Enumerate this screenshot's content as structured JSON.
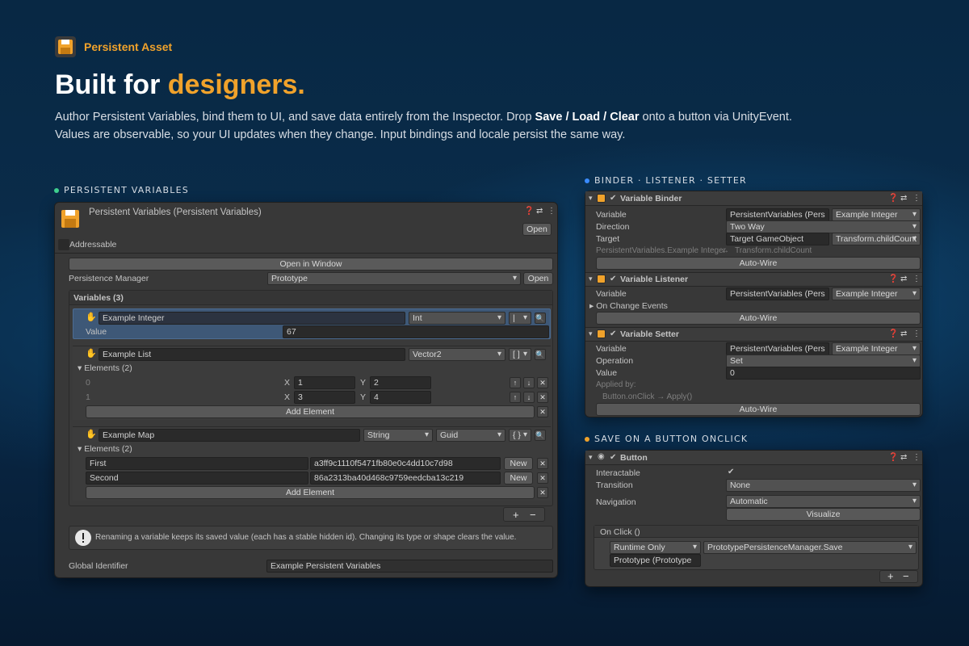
{
  "brand": {
    "name": "Persistent Asset",
    "icon": "floppy-disk-icon"
  },
  "headline": {
    "prefix": "Built for ",
    "accent": "designers."
  },
  "description": {
    "line1_a": "Author Persistent Variables, bind them to UI, and save data entirely from the Inspector. Drop ",
    "line1_b": "Save / Load / Clear",
    "line1_c": " onto a button via UnityEvent.",
    "line2": "Values are observable, so your UI updates when they change. Input bindings and locale persist the same way."
  },
  "colors": {
    "accent": "#f0a22b",
    "green_dot": "#3ecf8e",
    "blue_dot": "#3b8cff",
    "orange_dot": "#f0a22b"
  },
  "sections": {
    "persistent": "PERSISTENT VARIABLES",
    "binder": "BINDER · LISTENER · SETTER",
    "save": "SAVE ON A BUTTON ONCLICK"
  },
  "inspector": {
    "title": "Persistent Variables (Persistent Variables)",
    "open": "Open",
    "addressable": "Addressable",
    "open_window": "Open in Window",
    "pm_label": "Persistence Manager",
    "pm_value": "Prototype",
    "pm_open": "Open",
    "variables_header": "Variables (3)",
    "var1": {
      "name": "Example Integer",
      "type": "Int",
      "value_label": "Value",
      "value": "67",
      "shape": "|"
    },
    "var2": {
      "name": "Example List",
      "type": "Vector2",
      "shape": "[ ]",
      "elements": "Elements (2)",
      "rows": [
        {
          "idx": "0",
          "x": "1",
          "y": "2"
        },
        {
          "idx": "1",
          "x": "3",
          "y": "4"
        }
      ],
      "x_label": "X",
      "y_label": "Y",
      "add": "Add Element"
    },
    "var3": {
      "name": "Example Map",
      "key_type": "String",
      "value_type": "Guid",
      "shape": "{ }",
      "elements": "Elements (2)",
      "rows": [
        {
          "key": "First",
          "guid": "a3ff9c1110f5471fb80e0c4dd10c7d98",
          "btn": "New"
        },
        {
          "key": "Second",
          "guid": "86a2313ba40d468c9759eedcba13c219",
          "btn": "New"
        }
      ],
      "add": "Add Element"
    },
    "plus": "+",
    "minus": "−",
    "warning": "Renaming a variable keeps its saved value (each has a stable hidden id). Changing its type or shape clears the value.",
    "gid_label": "Global Identifier",
    "gid_value": "Example Persistent Variables"
  },
  "binder": {
    "title": "Variable Binder",
    "variable_label": "Variable",
    "variable_value": "PersistentVariables (Pers",
    "variable_sel": "Example Integer",
    "direction_label": "Direction",
    "direction_value": "Two Way",
    "target_label": "Target",
    "target_value": "Target GameObject",
    "target_sel": "Transform.childCount",
    "path_left": "PersistentVariables.Example Integer",
    "path_arrow": "↔",
    "path_right": "Transform.childCount",
    "autowire": "Auto-Wire"
  },
  "listener": {
    "title": "Variable Listener",
    "variable_label": "Variable",
    "variable_value": "PersistentVariables (Pers",
    "variable_sel": "Example Integer",
    "events": "On Change Events",
    "autowire": "Auto-Wire"
  },
  "setter": {
    "title": "Variable Setter",
    "variable_label": "Variable",
    "variable_value": "PersistentVariables (Pers",
    "variable_sel": "Example Integer",
    "operation_label": "Operation",
    "operation_value": "Set",
    "value_label": "Value",
    "value_value": "0",
    "applied_by": "Applied by:",
    "applied_detail": "Button.onClick → Apply()",
    "autowire": "Auto-Wire"
  },
  "button": {
    "title": "Button",
    "interactable_label": "Interactable",
    "interactable_check": "✔",
    "transition_label": "Transition",
    "transition_value": "None",
    "navigation_label": "Navigation",
    "navigation_value": "Automatic",
    "visualize": "Visualize",
    "onclick": "On Click ()",
    "runtime": "Runtime Only",
    "method": "PrototypePersistenceManager.Save",
    "object": "Prototype (Prototype",
    "plus": "+",
    "minus": "−"
  }
}
